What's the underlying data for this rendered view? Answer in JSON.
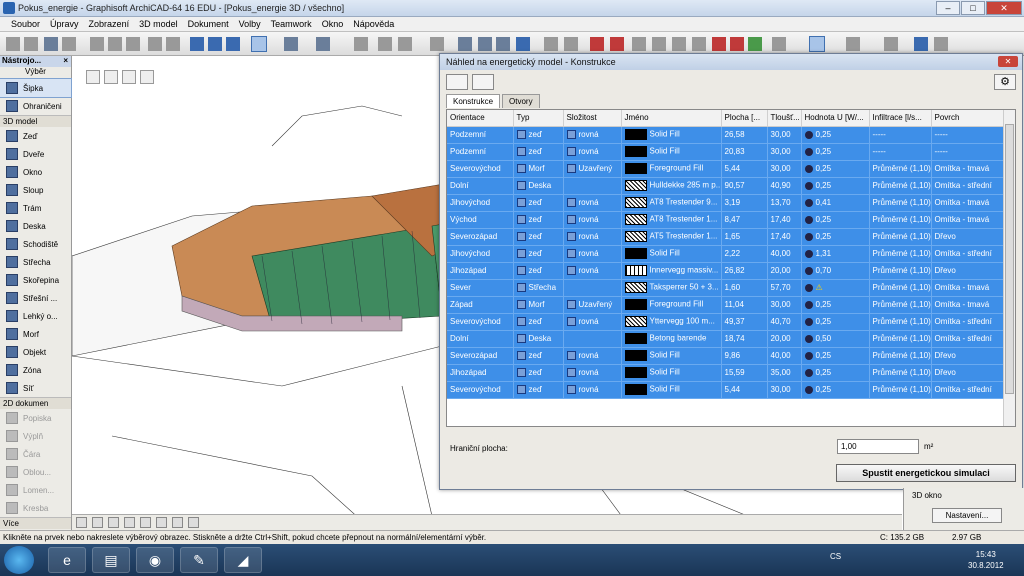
{
  "window": {
    "title": "Pokus_energie - Graphisoft ArchiCAD-64 16 EDU - [Pokus_energie 3D / všechno]"
  },
  "menu": [
    "Soubor",
    "Úpravy",
    "Zobrazení",
    "3D model",
    "Dokument",
    "Volby",
    "Teamwork",
    "Okno",
    "Nápověda"
  ],
  "toolbox": {
    "title": "Nástrojo...",
    "select_group": "Výběr",
    "select_items": [
      "Šipka",
      "Ohraničeni"
    ],
    "model_group": "3D model",
    "model_items": [
      "Zeď",
      "Dveře",
      "Okno",
      "Sloup",
      "Trám",
      "Deska",
      "Schodiště",
      "Střecha",
      "Skořepina",
      "Střešní ...",
      "Lehký o...",
      "Morf",
      "Objekt",
      "Zóna",
      "Síť"
    ],
    "doc_group": "2D dokumen",
    "doc_items": [
      "Popiska",
      "Výplň",
      "Čára",
      "Oblou...",
      "Lomen...",
      "Kresba"
    ],
    "more": "Více"
  },
  "dialog": {
    "title": "Náhled na energetický model - Konstrukce",
    "tabs": [
      "Konstrukce",
      "Otvory"
    ],
    "columns": [
      "Orientace",
      "Typ",
      "Složitost",
      "Jméno",
      "Plocha [...",
      "Tloušť...",
      "Hodnota U [W/...",
      "Infiltrace [l/s...",
      "Povrch"
    ],
    "rows": [
      {
        "orientace": "Podzemní",
        "typ": "zeď",
        "slozitost": "rovná",
        "jmeno": "Solid Fill",
        "plocha": "26,58",
        "tloustka": "30,00",
        "u": "0,25",
        "infiltrace": "-----",
        "povrch": "-----",
        "sw": "solid"
      },
      {
        "orientace": "Podzemní",
        "typ": "zeď",
        "slozitost": "rovná",
        "jmeno": "Solid Fill",
        "plocha": "20,83",
        "tloustka": "30,00",
        "u": "0,25",
        "infiltrace": "-----",
        "povrch": "-----",
        "sw": "solid"
      },
      {
        "orientace": "Severovýchod",
        "typ": "Morf",
        "slozitost": "Uzavřený",
        "jmeno": "Foreground Fill",
        "plocha": "5,44",
        "tloustka": "30,00",
        "u": "0,25",
        "infiltrace": "Průměrné (1,10)",
        "povrch": "Omítka - tmavá",
        "sw": "solid"
      },
      {
        "orientace": "Dolní",
        "typ": "Deska",
        "slozitost": "",
        "jmeno": "Hulldekke 285 m p...",
        "plocha": "90,57",
        "tloustka": "40,90",
        "u": "0,25",
        "infiltrace": "Průměrné (1,10)",
        "povrch": "Omítka - střední",
        "sw": "hatch"
      },
      {
        "orientace": "Jihovýchod",
        "typ": "zeď",
        "slozitost": "rovná",
        "jmeno": "AT8 Trestender 9...",
        "plocha": "3,19",
        "tloustka": "13,70",
        "u": "0,41",
        "infiltrace": "Průměrné (1,10)",
        "povrch": "Omítka - tmavá",
        "sw": "hatch"
      },
      {
        "orientace": "Východ",
        "typ": "zeď",
        "slozitost": "rovná",
        "jmeno": "AT8 Trestender 1...",
        "plocha": "8,47",
        "tloustka": "17,40",
        "u": "0,25",
        "infiltrace": "Průměrné (1,10)",
        "povrch": "Omítka - tmavá",
        "sw": "hatch"
      },
      {
        "orientace": "Severozápad",
        "typ": "zeď",
        "slozitost": "rovná",
        "jmeno": "AT5 Trestender 1...",
        "plocha": "1,65",
        "tloustka": "17,40",
        "u": "0,25",
        "infiltrace": "Průměrné (1,10)",
        "povrch": "Dřevo",
        "sw": "hatch"
      },
      {
        "orientace": "Jihovýchod",
        "typ": "zeď",
        "slozitost": "rovná",
        "jmeno": "Solid Fill",
        "plocha": "2,22",
        "tloustka": "40,00",
        "u": "1,31",
        "infiltrace": "Průměrné (1,10)",
        "povrch": "Omítka - střední",
        "sw": "solid"
      },
      {
        "orientace": "Jihozápad",
        "typ": "zeď",
        "slozitost": "rovná",
        "jmeno": "Innervegg massiv...",
        "plocha": "26,82",
        "tloustka": "20,00",
        "u": "0,70",
        "infiltrace": "Průměrné (1,10)",
        "povrch": "Dřevo",
        "sw": "lines"
      },
      {
        "orientace": "Sever",
        "typ": "Střecha",
        "slozitost": "",
        "jmeno": "Taksperrer 50 + 3...",
        "plocha": "1,60",
        "tloustka": "57,70",
        "u": "",
        "infiltrace": "Průměrné (1,10)",
        "povrch": "Omítka - tmavá",
        "sw": "hatch"
      },
      {
        "orientace": "Západ",
        "typ": "Morf",
        "slozitost": "Uzavřený",
        "jmeno": "Foreground Fill",
        "plocha": "11,04",
        "tloustka": "30,00",
        "u": "0,25",
        "infiltrace": "Průměrné (1,10)",
        "povrch": "Omítka - tmavá",
        "sw": "solid"
      },
      {
        "orientace": "Severovýchod",
        "typ": "zeď",
        "slozitost": "rovná",
        "jmeno": "Yttervegg 100 m...",
        "plocha": "49,37",
        "tloustka": "40,70",
        "u": "0,25",
        "infiltrace": "Průměrné (1,10)",
        "povrch": "Omítka - střední",
        "sw": "hatch"
      },
      {
        "orientace": "Dolní",
        "typ": "Deska",
        "slozitost": "",
        "jmeno": "Betong barende",
        "plocha": "18,74",
        "tloustka": "20,00",
        "u": "0,50",
        "infiltrace": "Průměrné (1,10)",
        "povrch": "Omítka - střední",
        "sw": "solid"
      },
      {
        "orientace": "Severozápad",
        "typ": "zeď",
        "slozitost": "rovná",
        "jmeno": "Solid Fill",
        "plocha": "9,86",
        "tloustka": "40,00",
        "u": "0,25",
        "infiltrace": "Průměrné (1,10)",
        "povrch": "Dřevo",
        "sw": "solid"
      },
      {
        "orientace": "Jihozápad",
        "typ": "zeď",
        "slozitost": "rovná",
        "jmeno": "Solid Fill",
        "plocha": "15,59",
        "tloustka": "35,00",
        "u": "0,25",
        "infiltrace": "Průměrné (1,10)",
        "povrch": "Dřevo",
        "sw": "solid"
      },
      {
        "orientace": "Severovýchod",
        "typ": "zeď",
        "slozitost": "rovná",
        "jmeno": "Solid Fill",
        "plocha": "5,44",
        "tloustka": "30,00",
        "u": "0,25",
        "infiltrace": "Průměrné (1,10)",
        "povrch": "Omítka - střední",
        "sw": "solid"
      }
    ],
    "boundary_label": "Hraniční plocha:",
    "boundary_value": "1,00",
    "boundary_unit": "m²",
    "simulate_button": "Spustit energetickou simulaci"
  },
  "side_panel": {
    "label": "3D okno",
    "button": "Nastavení..."
  },
  "status": {
    "message": "Klikněte na prvek nebo nakreslete výběrový obrazec. Stiskněte a držte Ctrl+Shift, pokud chcete přepnout na normální/elementární výběr.",
    "disk_c": "C: 135.2 GB",
    "ram": "2.97 GB"
  },
  "taskbar": {
    "lang": "CS",
    "time": "15:43",
    "date": "30.8.2012"
  },
  "colors": {
    "selection": "#3e8fe8",
    "accent": "#2a64b0"
  }
}
